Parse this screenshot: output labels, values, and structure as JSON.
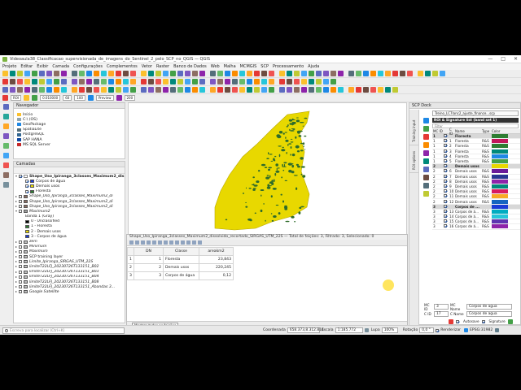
{
  "window": {
    "title": "Videoaula38_Classificacao_supervisionada_de_imagens_do_Sentinel_2_pelo_SCP_no_QGIS — QGIS",
    "controls": [
      "—",
      "□",
      "✕"
    ]
  },
  "menu": [
    "Projeto",
    "Editar",
    "Exibir",
    "Camada",
    "Configurações",
    "Complementos",
    "Vetor",
    "Raster",
    "Banco de Dados",
    "Web",
    "Malha",
    "MCMGIS",
    "SCP",
    "Processamento",
    "Ajuda"
  ],
  "toolbar": {
    "roi_label": "ROI",
    "scale1": "0.010000",
    "scale2": "60",
    "scale3": "100",
    "preview": "Preview",
    "size": "200"
  },
  "browser": {
    "title": "Navegador",
    "items": [
      "Início",
      "C:\\ (OS)",
      "GeoPackage",
      "SpatiaLite",
      "PostgreSQL",
      "SAP HANA",
      "MS SQL Server"
    ]
  },
  "layers": {
    "title": "Camadas",
    "items": [
      {
        "text": "Shape_Uso_Ipiranga_3classes_Maximum2_dis",
        "kind": "group",
        "checked": true,
        "bold": true
      },
      {
        "text": "Corpos de água",
        "kind": "class",
        "checked": true,
        "color": "#1a3bd6"
      },
      {
        "text": "Demais usos",
        "kind": "class",
        "checked": true,
        "color": "#e8d800"
      },
      {
        "text": "Floresta",
        "kind": "class",
        "checked": true,
        "color": "#2e7d32"
      },
      {
        "text": "Shape_Uso_Ipiranga_3classes_Maximum2_di",
        "kind": "layer",
        "checked": false,
        "italic": true,
        "color": "#8d6e63"
      },
      {
        "text": "Shape_Uso_Ipiranga_3classes_Maximum2_di",
        "kind": "layer",
        "checked": false,
        "italic": true,
        "color": "#8d6e63"
      },
      {
        "text": "Shape_Uso_Ipiranga_3classes_Maximum2_di",
        "kind": "layer",
        "checked": false,
        "italic": true,
        "color": "#8d6e63"
      },
      {
        "text": "Maximum2",
        "kind": "raster",
        "checked": false,
        "italic": true
      },
      {
        "text": "Banda 1 (Gray)",
        "kind": "label"
      },
      {
        "text": "0 - Unclassified",
        "kind": "class",
        "color": "#000000"
      },
      {
        "text": "1 - Floresta",
        "kind": "class",
        "color": "#2e7d32"
      },
      {
        "text": "2 - Demais usos",
        "kind": "class",
        "color": "#e8d800"
      },
      {
        "text": "3 - Corpos de água",
        "kind": "class",
        "color": "#1a3bd6"
      },
      {
        "text": "zem",
        "kind": "layer",
        "checked": false,
        "italic": true
      },
      {
        "text": "Minimum",
        "kind": "layer",
        "checked": false,
        "italic": true
      },
      {
        "text": "Maximum",
        "kind": "layer",
        "checked": false,
        "italic": true
      },
      {
        "text": "SCP training layer",
        "kind": "layer",
        "checked": false
      },
      {
        "text": "Limite_Ipiranga_SIRGAS_UTM_22S",
        "kind": "layer",
        "checked": false,
        "italic": true
      },
      {
        "text": "limiteT22LFJ_20230726T133151_B02",
        "kind": "layer",
        "checked": false,
        "italic": true
      },
      {
        "text": "limiteT22LFJ_20230726T133151_B03",
        "kind": "layer",
        "checked": false,
        "italic": true
      },
      {
        "text": "limiteT22LFJ_20230726T133151_B04",
        "kind": "layer",
        "checked": false,
        "italic": true
      },
      {
        "text": "limiteT22LFJ_20230726T133151_B08",
        "kind": "layer",
        "checked": false,
        "italic": true
      },
      {
        "text": "limiteT22LFJ_20230726T133151_Abandas 3...",
        "kind": "layer",
        "checked": false,
        "italic": true
      },
      {
        "text": "Google Satellite",
        "kind": "layer",
        "checked": false,
        "italic": true
      }
    ]
  },
  "attribute_table": {
    "title": "Shape_Uso_Ipiranga_3classes_Maximum2_dissolvido_recortado_SIRGAS_UTM_22S — Total de feições: 3, Filtrado: 3, Selecionado: 0",
    "columns": [
      "DN",
      "Classe",
      "areakm2"
    ],
    "rows": [
      {
        "n": "1",
        "DN": "1",
        "Classe": "Floresta",
        "areakm2": "23,843"
      },
      {
        "n": "2",
        "DN": "2",
        "Classe": "Demais usos",
        "areakm2": "220,245"
      },
      {
        "n": "3",
        "DN": "3",
        "Classe": "Corpos de água",
        "areakm2": "0,12"
      }
    ],
    "footer_button": "Mostrar todas as feições"
  },
  "scp": {
    "title": "SCP Dock",
    "tabs": [
      "Training input",
      "ROI options"
    ],
    "file": "Treino_LC7lanc2_ajuste_finance...scp",
    "roi_title": "ROI & Signature list (band set 1)",
    "filter": "Filter",
    "columns": [
      "MC ID",
      "C ID",
      "Name",
      "Type",
      "Color"
    ],
    "rows": [
      {
        "mc": "1",
        "c": "",
        "name": "Floresta",
        "type": "",
        "color": "#2e7d32",
        "macro": true
      },
      {
        "mc": "1",
        "c": "1",
        "name": "Floresta",
        "type": "R&S",
        "color": "#c2185b"
      },
      {
        "mc": "1",
        "c": "2",
        "name": "Floresta",
        "type": "R&S",
        "color": "#2e7d32"
      },
      {
        "mc": "1",
        "c": "3",
        "name": "Floresta",
        "type": "R&S",
        "color": "#00897b"
      },
      {
        "mc": "1",
        "c": "4",
        "name": "Floresta",
        "type": "R&S",
        "color": "#1e88e5"
      },
      {
        "mc": "1",
        "c": "5",
        "name": "Floresta",
        "type": "R&S",
        "color": "#43a047"
      },
      {
        "mc": "2",
        "c": "",
        "name": "Demais usos",
        "type": "",
        "color": "#e8d800",
        "macro": true
      },
      {
        "mc": "2",
        "c": "6",
        "name": "Demais usos",
        "type": "R&S",
        "color": "#6a1b9a"
      },
      {
        "mc": "2",
        "c": "7",
        "name": "Demais usos",
        "type": "R&S",
        "color": "#283593"
      },
      {
        "mc": "2",
        "c": "8",
        "name": "Demais usos",
        "type": "R&S",
        "color": "#8e24aa"
      },
      {
        "mc": "2",
        "c": "9",
        "name": "Demais usos",
        "type": "R&S",
        "color": "#00897b"
      },
      {
        "mc": "2",
        "c": "10",
        "name": "Demais usos",
        "type": "R&S",
        "color": "#d81b60"
      },
      {
        "mc": "2",
        "c": "11",
        "name": "Demais usos",
        "type": "R&S",
        "color": "#f9a825"
      },
      {
        "mc": "2",
        "c": "12",
        "name": "Demais usos",
        "type": "R&S",
        "color": "#1565c0"
      },
      {
        "mc": "3",
        "c": "",
        "name": "Corpos de ...",
        "type": "",
        "color": "#1a3bd6",
        "macro": true
      },
      {
        "mc": "3",
        "c": "13",
        "name": "Corpos de á...",
        "type": "R&S",
        "color": "#00acc1"
      },
      {
        "mc": "3",
        "c": "14",
        "name": "Corpos de á...",
        "type": "R&S",
        "color": "#26c6da"
      },
      {
        "mc": "3",
        "c": "15",
        "name": "Corpos de á...",
        "type": "R&S",
        "color": "#5e35b1"
      },
      {
        "mc": "3",
        "c": "16",
        "name": "Corpos de á...",
        "type": "R&S",
        "color": "#8e24aa"
      }
    ],
    "mc_id_label": "MC ID",
    "mc_id_value": "3",
    "mc_name_label": "MC Name",
    "mc_name_value": "Corpos de agua",
    "c_id_label": "C ID",
    "c_id_value": "17",
    "c_name_label": "C Name",
    "c_name_value": "Corpos de agua",
    "autosave": "Autosave",
    "signature": "Signature"
  },
  "status": {
    "search_placeholder": "Escreva para localizar (Ctrl+K)",
    "coord_label": "Coordenada",
    "coord_value": "658.373,8.312.814",
    "scale_label": "Escala",
    "scale_value": "1:185.772",
    "mag_label": "Lupa",
    "mag_value": "100%",
    "rot_label": "Rotação",
    "rot_value": "0,0 °",
    "render": "Renderizar",
    "crs": "EPSG:31982"
  }
}
